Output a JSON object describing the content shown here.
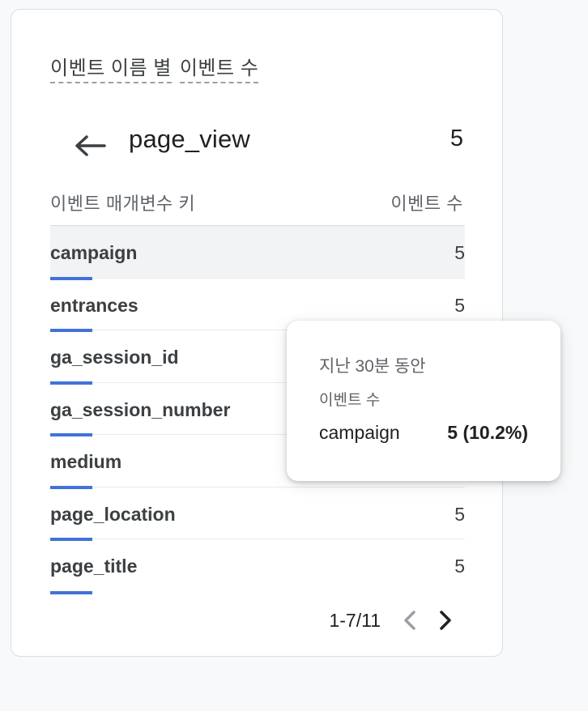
{
  "card": {
    "title_part1": "이벤트 이름 별",
    "title_part2": "이벤트 수",
    "event_name": "page_view",
    "event_count": "5",
    "column_key_header": "이벤트 매개변수 키",
    "column_value_header": "이벤트 수",
    "rows": [
      {
        "key": "campaign",
        "value": "5"
      },
      {
        "key": "entrances",
        "value": "5"
      },
      {
        "key": "ga_session_id",
        "value": ""
      },
      {
        "key": "ga_session_number",
        "value": ""
      },
      {
        "key": "medium",
        "value": ""
      },
      {
        "key": "page_location",
        "value": "5"
      },
      {
        "key": "page_title",
        "value": "5"
      }
    ],
    "pagination": {
      "range": "1-7/11",
      "prev_icon": "chevron-left-icon",
      "next_icon": "chevron-right-icon"
    },
    "back_icon": "arrow-left-icon"
  },
  "tooltip": {
    "period": "지난 30분 동안",
    "metric": "이벤트 수",
    "key": "campaign",
    "value": "5 (10.2%)"
  },
  "colors": {
    "bar": "#4172d8",
    "selected_row": "#f1f3f4",
    "border": "#dadce0"
  }
}
